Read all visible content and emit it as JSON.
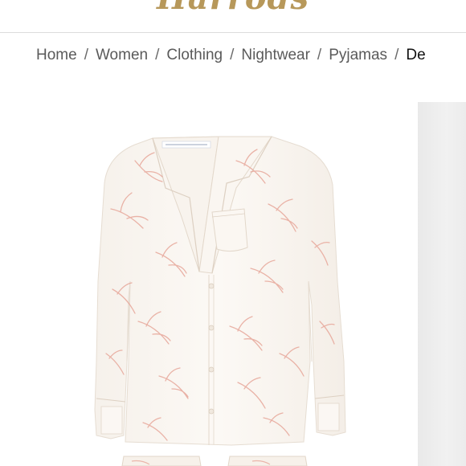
{
  "header": {
    "logo_text": "Harrods"
  },
  "breadcrumb": {
    "items": [
      "Home",
      "Women",
      "Clothing",
      "Nightwear",
      "Pyjamas"
    ],
    "current": "De",
    "separator": "/"
  },
  "product": {
    "image_label": "ivory-pyjama-shirt-with-pink-leaf-print"
  },
  "colors": {
    "brand_gold": "#b7985a",
    "breadcrumb_text": "#5a5a5a",
    "shirt_fabric": "#faf6f1",
    "print_pink": "#e7a79a"
  }
}
